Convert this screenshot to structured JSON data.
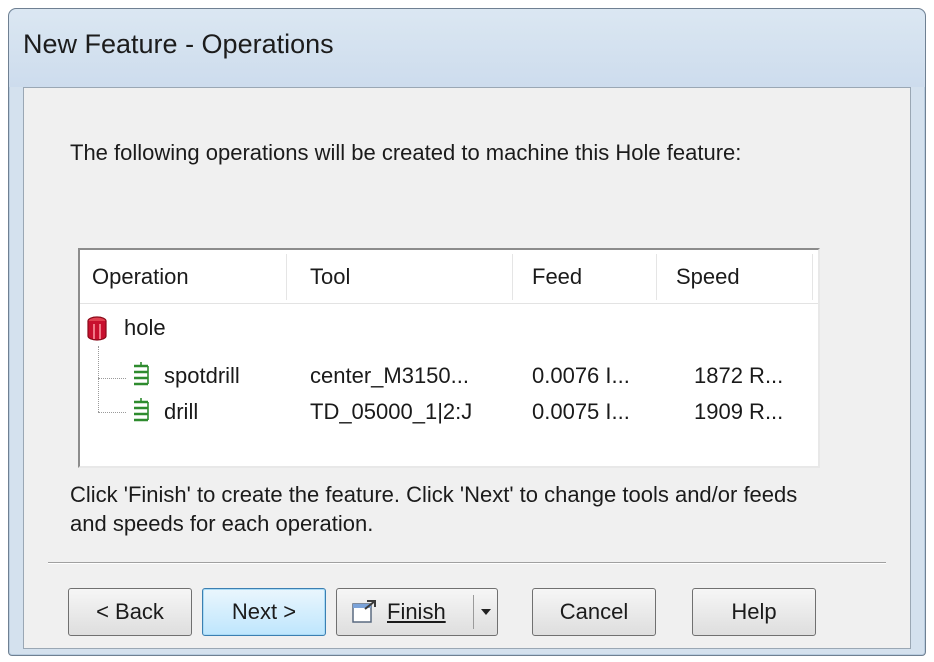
{
  "window": {
    "title": "New Feature - Operations"
  },
  "intro_text": "The following operations will be created to machine this Hole feature:",
  "list": {
    "headers": [
      "Operation",
      "Tool",
      "Feed",
      "Speed"
    ],
    "parent": {
      "label": "hole",
      "icon": "hole-feature-icon"
    },
    "rows": [
      {
        "operation": "spotdrill",
        "tool": "center_M3150...",
        "feed": "0.0076 I...",
        "speed": "1872 R...",
        "icon": "drill-operation-icon"
      },
      {
        "operation": "drill",
        "tool": "TD_05000_1|2:J",
        "feed": "0.0075 I...",
        "speed": "1909 R...",
        "icon": "drill-operation-icon"
      }
    ]
  },
  "hint_text": "Click 'Finish' to create the feature.  Click 'Next' to change tools and/or feeds and speeds for each operation.",
  "buttons": {
    "back": "< Back",
    "next": "Next >",
    "finish": "Finish",
    "cancel": "Cancel",
    "help": "Help"
  },
  "colors": {
    "hole_icon": "#c8102e",
    "operation_icon": "#2e8b2e",
    "default_button_border": "#3c7fb1"
  }
}
